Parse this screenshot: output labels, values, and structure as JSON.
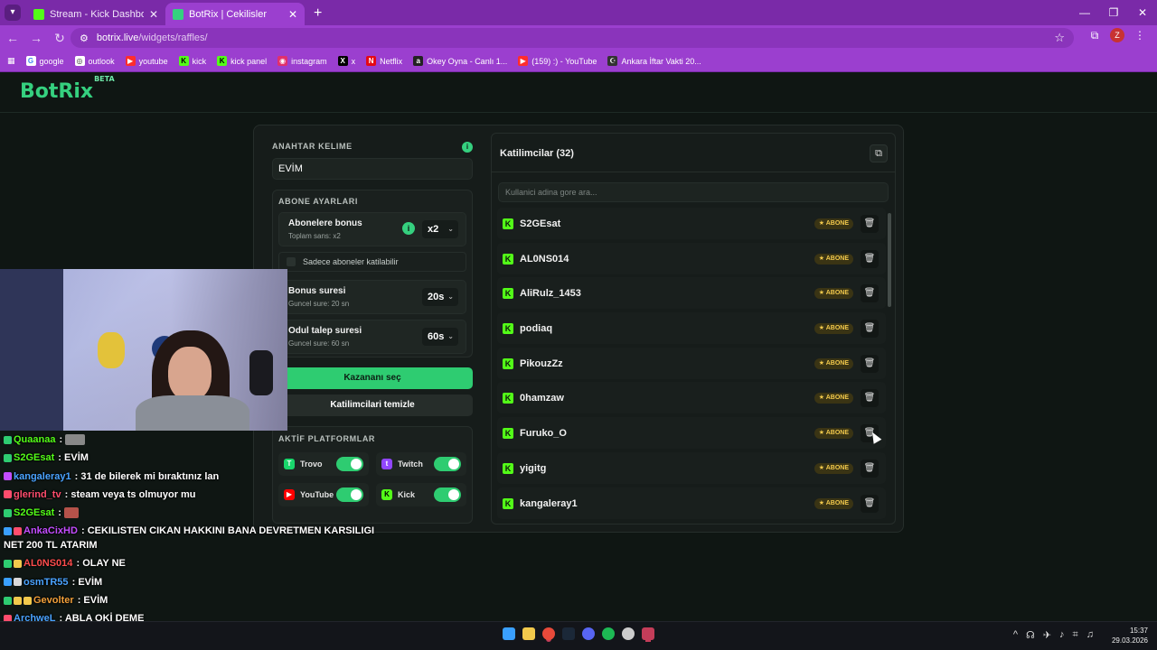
{
  "browser": {
    "tabs": [
      {
        "title": "Stream - Kick Dashboard",
        "active": false,
        "favicon_color": "#53fc18"
      },
      {
        "title": "BotRix | Cekilisler",
        "active": true,
        "favicon_color": "#35d07f"
      }
    ],
    "url_host": "botrix.live",
    "url_path": "/widgets/raffles/",
    "profile_initial": "Z",
    "bookmarks": [
      {
        "label": "google",
        "icon": "google-icon",
        "color": "#ffffff"
      },
      {
        "label": "outlook",
        "icon": "outlook-icon",
        "color": "#ffffff"
      },
      {
        "label": "youtube",
        "icon": "youtube-icon",
        "color": "#ff2d2d"
      },
      {
        "label": "kick",
        "icon": "kick-icon",
        "color": "#53fc18"
      },
      {
        "label": "kick panel",
        "icon": "kick-icon",
        "color": "#53fc18"
      },
      {
        "label": "instagram",
        "icon": "instagram-icon",
        "color": "#e1306c"
      },
      {
        "label": "x",
        "icon": "x-icon",
        "color": "#000000"
      },
      {
        "label": "Netflix",
        "icon": "netflix-icon",
        "color": "#e50914"
      },
      {
        "label": "Okey Oyna - Canlı 1...",
        "icon": "okey-icon",
        "color": "#222222"
      },
      {
        "label": "(159) :) - YouTube",
        "icon": "youtube-icon",
        "color": "#ff2d2d"
      },
      {
        "label": "Ankara İftar Vakti 20...",
        "icon": "mosque-icon",
        "color": "#333333"
      }
    ]
  },
  "app": {
    "logo": "BotRix",
    "logo_tag": "BETA",
    "accent": "#35d07f"
  },
  "raffle": {
    "keyword_title": "ANAHTAR KELIME",
    "keyword_value": "EVİM",
    "sub_settings_title": "ABONE AYARLARI",
    "sub_bonus_label": "Abonelere bonus",
    "sub_bonus_sub": "Toplam sans: x2",
    "sub_bonus_value": "x2",
    "subs_only_label": "Sadece aboneler katilabilir",
    "bonus_time_label": "Bonus suresi",
    "bonus_time_sub": "Guncel sure: 20 sn",
    "bonus_time_value": "20s",
    "claim_time_label": "Odul talep suresi",
    "claim_time_sub": "Guncel sure: 60 sn",
    "claim_time_value": "60s",
    "pick_winner": "Kazananı seç",
    "clear_participants": "Katilimcilari temizle",
    "platforms_title": "AKTİF PLATFORMLAR",
    "platforms": [
      {
        "name": "Trovo",
        "enabled": true,
        "color": "#19d66b",
        "icon": "trovo-icon"
      },
      {
        "name": "Twitch",
        "enabled": true,
        "color": "#9146ff",
        "icon": "twitch-icon"
      },
      {
        "name": "YouTube",
        "enabled": true,
        "color": "#ff0000",
        "icon": "youtube-icon"
      },
      {
        "name": "Kick",
        "enabled": true,
        "color": "#53fc18",
        "icon": "kick-icon"
      }
    ]
  },
  "participants": {
    "title": "Katilimcilar (32)",
    "search_placeholder": "Kullanici adina gore ara...",
    "badge": "ABONE",
    "items": [
      {
        "name": "S2GEsat"
      },
      {
        "name": "AL0NS014"
      },
      {
        "name": "AliRulz_1453"
      },
      {
        "name": "podiaq"
      },
      {
        "name": "PikouzZz"
      },
      {
        "name": "0hamzaw"
      },
      {
        "name": "Furuko_O"
      },
      {
        "name": "yigitg"
      },
      {
        "name": "kangaleray1"
      }
    ]
  },
  "chat": [
    {
      "user": "Quaanaa",
      "color": "#53fc18",
      "msg": "",
      "badges": [
        "#2ecc71"
      ]
    },
    {
      "user": "S2GEsat",
      "color": "#53fc18",
      "msg": "EVİM",
      "badges": [
        "#2ecc71"
      ]
    },
    {
      "user": "kangaleray1",
      "color": "#4aa3ff",
      "msg": "31 de bilerek mi bıraktınız lan",
      "badges": [
        "#c34dff"
      ]
    },
    {
      "user": "glerind_tv",
      "color": "#ff4d6d",
      "msg": "steam veya ts olmuyor mu",
      "badges": [
        "#ff4d6d"
      ]
    },
    {
      "user": "S2GEsat",
      "color": "#53fc18",
      "msg": "",
      "badges": [
        "#2ecc71"
      ],
      "emote": true
    },
    {
      "user": "AnkaCixHD",
      "color": "#c34dff",
      "msg": "CEKILISTEN CIKAN HAKKINI BANA DEVRETMEN KARSILIGI NET 200 TL ATARIM",
      "badges": [
        "#3aa0ff",
        "#ff4d6d"
      ],
      "wrap": true
    },
    {
      "user": "AL0NS014",
      "color": "#ff4d4d",
      "msg": "OLAY NE",
      "badges": [
        "#2ecc71",
        "#f2c94c"
      ]
    },
    {
      "user": "osmTR55",
      "color": "#4aa3ff",
      "msg": "EVİM",
      "badges": [
        "#3aa0ff",
        "#d9d9d9"
      ]
    },
    {
      "user": "Gevolter",
      "color": "#f2a03a",
      "msg": "EVİM",
      "badges": [
        "#2ecc71",
        "#f2c94c",
        "#f2c94c"
      ]
    },
    {
      "user": "ArchweL",
      "color": "#4aa3ff",
      "msg": "ABLA OKİ DEME",
      "badges": [
        "#ff4d6d"
      ]
    }
  ],
  "taskbar": {
    "time": "15:37",
    "date": "29.03.2026"
  }
}
